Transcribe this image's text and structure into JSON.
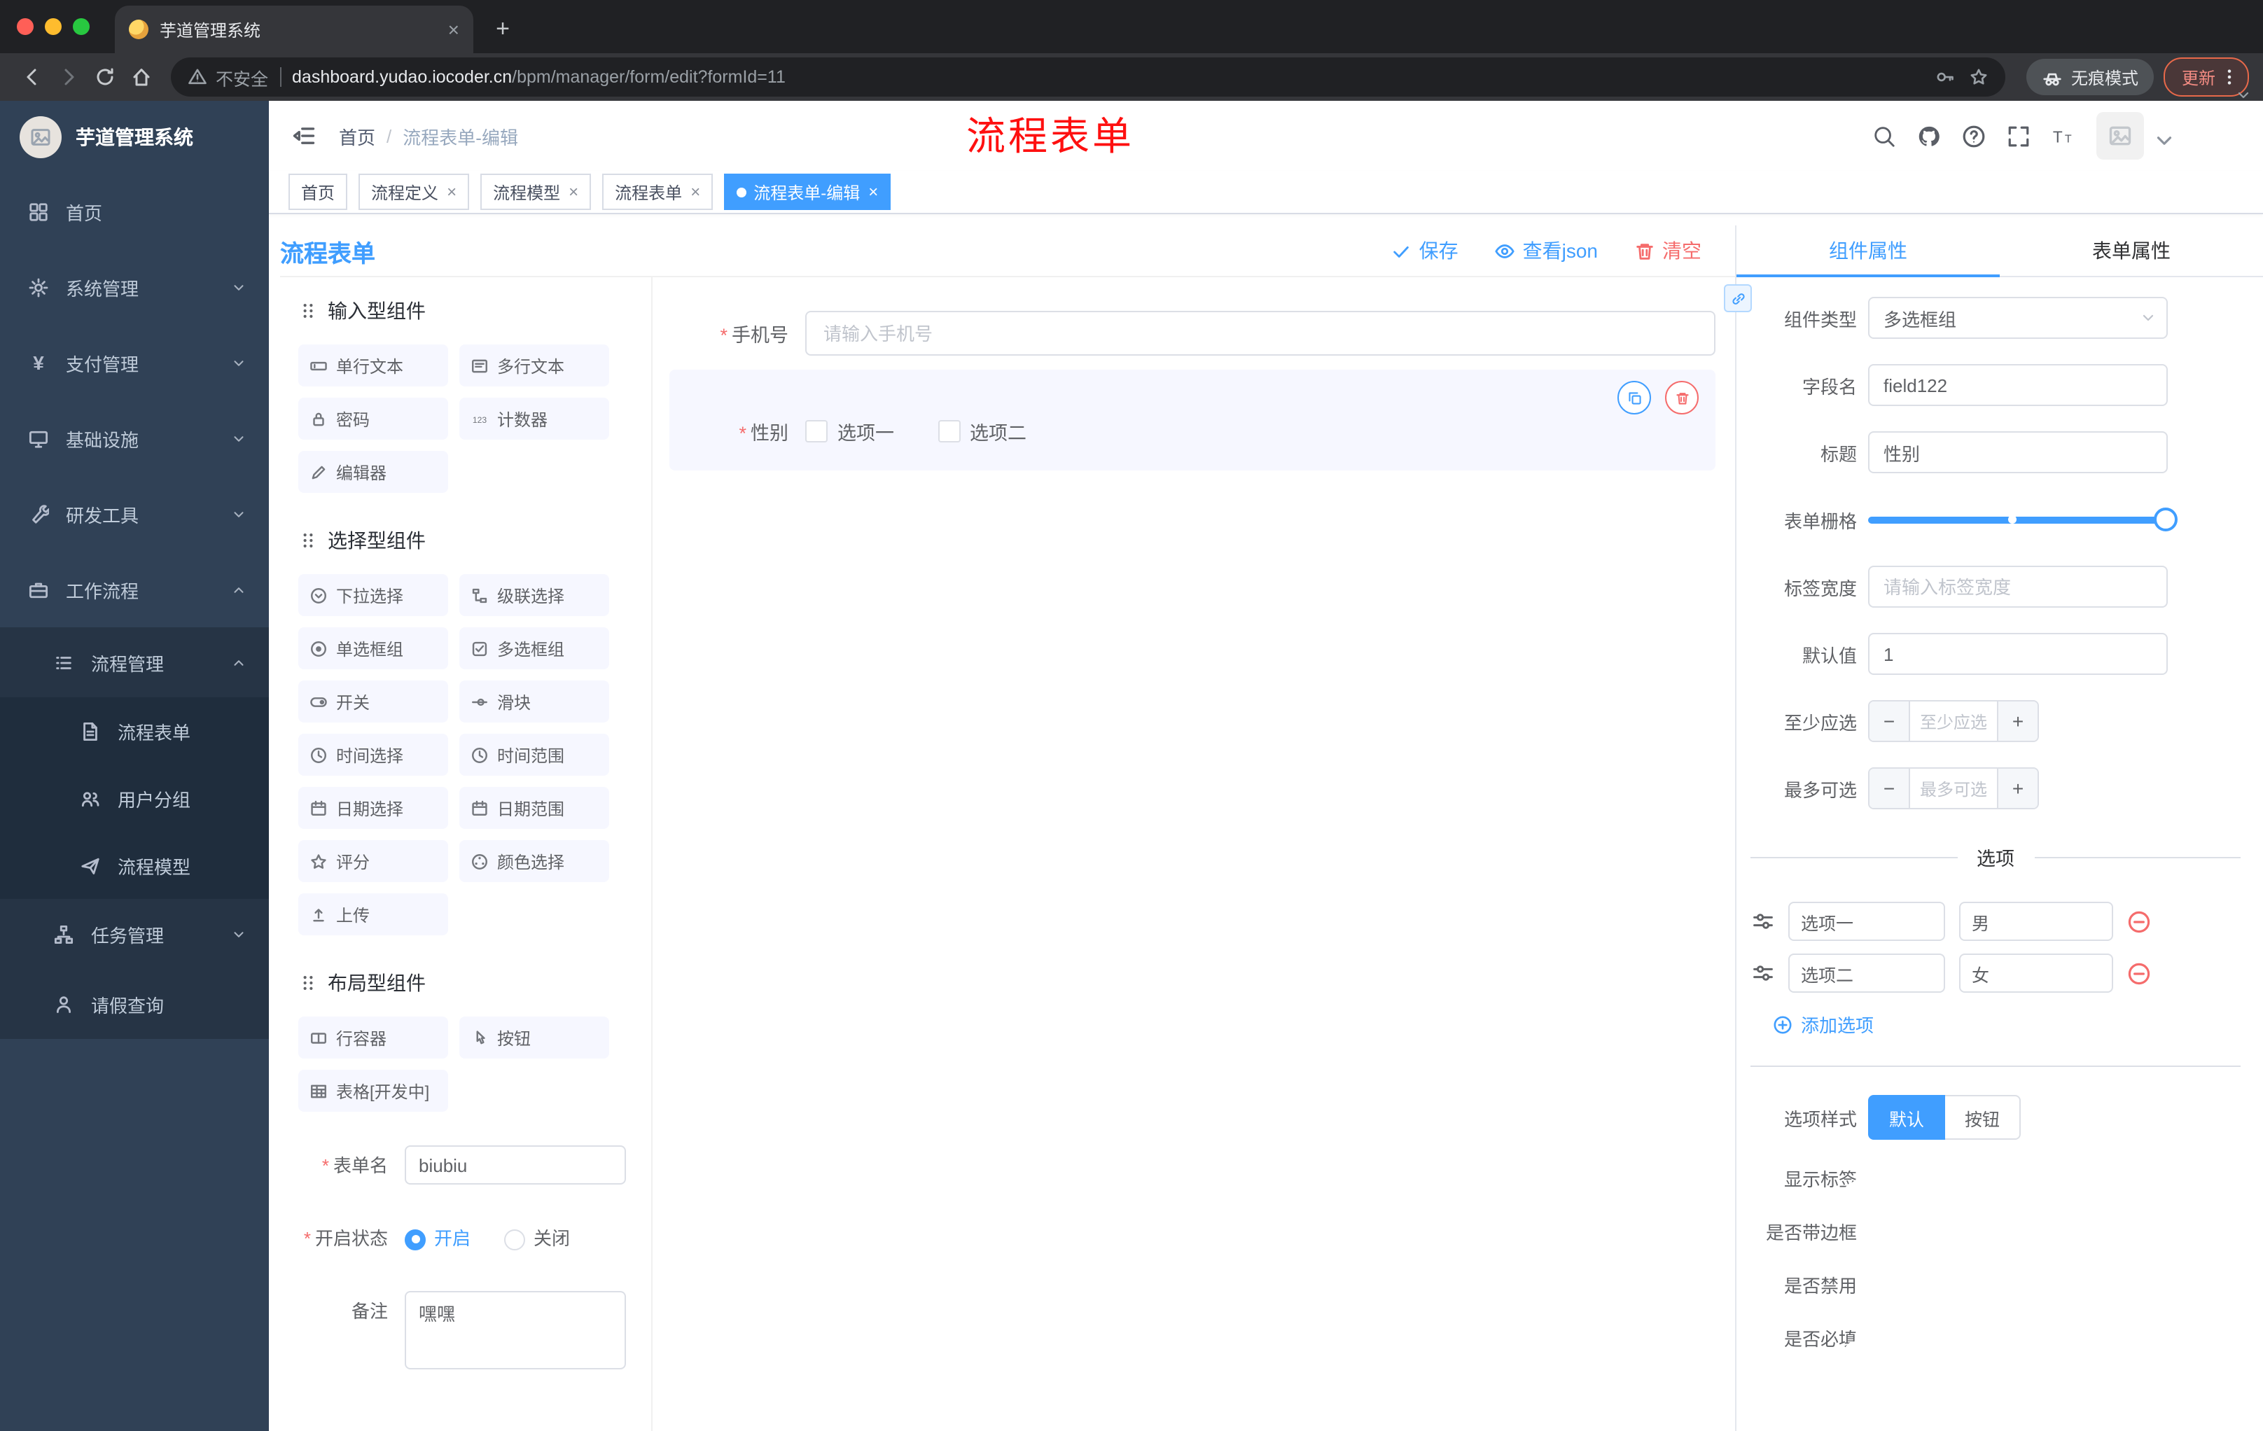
{
  "glyphs": {
    "close": "×",
    "plus": "+",
    "minus": "−",
    "slash": "/",
    "yen": "¥"
  },
  "browser": {
    "tab_title": "芋道管理系统",
    "security_label": "不安全",
    "url_host": "dashboard.yudao.iocoder.cn",
    "url_path": "/bpm/manager/form/edit?formId=11",
    "incognito_label": "无痕模式",
    "update_label": "更新"
  },
  "sidebar": {
    "logo_title": "芋道管理系统",
    "items": [
      {
        "label": "首页",
        "icon": "dashboard-icon"
      },
      {
        "label": "系统管理",
        "icon": "gear-icon"
      },
      {
        "label": "支付管理",
        "icon": "yen-icon"
      },
      {
        "label": "基础设施",
        "icon": "monitor-icon"
      },
      {
        "label": "研发工具",
        "icon": "tool-icon"
      },
      {
        "label": "工作流程",
        "icon": "briefcase-icon"
      }
    ],
    "process_group": {
      "label": "流程管理",
      "icon": "list-icon"
    },
    "process_children": [
      {
        "label": "流程表单",
        "icon": "document-icon"
      },
      {
        "label": "用户分组",
        "icon": "users-icon"
      },
      {
        "label": "流程模型",
        "icon": "send-icon"
      }
    ],
    "task_group": {
      "label": "任务管理",
      "icon": "tree-icon"
    },
    "leave_item": {
      "label": "请假查询",
      "icon": "user-icon"
    }
  },
  "navbar": {
    "breadcrumb_home": "首页",
    "breadcrumb_current": "流程表单-编辑",
    "annotation": "流程表单"
  },
  "tags": [
    {
      "label": "首页"
    },
    {
      "label": "流程定义"
    },
    {
      "label": "流程模型"
    },
    {
      "label": "流程表单"
    },
    {
      "label": "流程表单-编辑"
    }
  ],
  "editor": {
    "title": "流程表单",
    "actions": {
      "save": "保存",
      "view_json": "查看json",
      "clear": "清空"
    },
    "palette": {
      "groups": [
        {
          "title": "输入型组件",
          "items": [
            {
              "label": "单行文本",
              "icon": "input-icon"
            },
            {
              "label": "多行文本",
              "icon": "textarea-icon"
            },
            {
              "label": "密码",
              "icon": "lock-icon"
            },
            {
              "label": "计数器",
              "icon": "counter-icon"
            },
            {
              "label": "编辑器",
              "icon": "editor-icon"
            }
          ]
        },
        {
          "title": "选择型组件",
          "items": [
            {
              "label": "下拉选择",
              "icon": "select-icon"
            },
            {
              "label": "级联选择",
              "icon": "cascader-icon"
            },
            {
              "label": "单选框组",
              "icon": "radio-icon"
            },
            {
              "label": "多选框组",
              "icon": "checkbox-icon"
            },
            {
              "label": "开关",
              "icon": "switch-icon"
            },
            {
              "label": "滑块",
              "icon": "slider-icon"
            },
            {
              "label": "时间选择",
              "icon": "time-icon"
            },
            {
              "label": "时间范围",
              "icon": "time-range-icon"
            },
            {
              "label": "日期选择",
              "icon": "date-icon"
            },
            {
              "label": "日期范围",
              "icon": "date-range-icon"
            },
            {
              "label": "评分",
              "icon": "rate-icon"
            },
            {
              "label": "颜色选择",
              "icon": "color-icon"
            },
            {
              "label": "上传",
              "icon": "upload-icon"
            }
          ]
        },
        {
          "title": "布局型组件",
          "items": [
            {
              "label": "行容器",
              "icon": "row-icon"
            },
            {
              "label": "按钮",
              "icon": "button-icon"
            },
            {
              "label": "表格[开发中]",
              "icon": "table-icon"
            }
          ]
        }
      ]
    },
    "meta": {
      "form_name_label": "表单名",
      "form_name_value": "biubiu",
      "status_label": "开启状态",
      "status_on": "开启",
      "status_off": "关闭",
      "remark_label": "备注",
      "remark_value": "嘿嘿"
    },
    "canvas": {
      "phone_label": "手机号",
      "phone_placeholder": "请输入手机号",
      "gender_label": "性别",
      "gender_opt1": "选项一",
      "gender_opt2": "选项二"
    }
  },
  "panel": {
    "tab_component": "组件属性",
    "tab_form": "表单属性",
    "component_type_label": "组件类型",
    "component_type_value": "多选框组",
    "field_name_label": "字段名",
    "field_name_value": "field122",
    "title_label": "标题",
    "title_value": "性别",
    "grid_label": "表单栅格",
    "label_width_label": "标签宽度",
    "label_width_placeholder": "请输入标签宽度",
    "default_label": "默认值",
    "default_value": "1",
    "min_label": "至少应选",
    "min_placeholder": "至少应选",
    "max_label": "最多可选",
    "max_placeholder": "最多可选",
    "options_title": "选项",
    "options": [
      {
        "label": "选项一",
        "value": "男"
      },
      {
        "label": "选项二",
        "value": "女"
      }
    ],
    "add_option": "添加选项",
    "option_style_label": "选项样式",
    "style_default": "默认",
    "style_button": "按钮",
    "toggles": [
      {
        "label": "显示标签",
        "on": true
      },
      {
        "label": "是否带边框",
        "on": false
      },
      {
        "label": "是否禁用",
        "on": false
      },
      {
        "label": "是否必填",
        "on": true
      }
    ]
  },
  "colors": {
    "accent": "#409EFF",
    "danger": "#F56C6C",
    "sidebar_bg": "#304156",
    "annotation_red": "#FE1010"
  }
}
